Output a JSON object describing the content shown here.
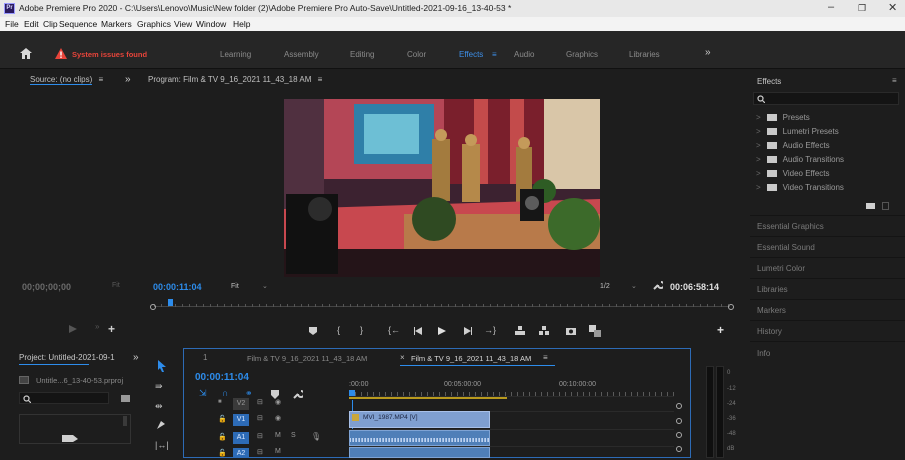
{
  "window": {
    "title": "Adobe Premiere Pro 2020 - C:\\Users\\Lenovo\\Music\\New folder (2)\\Adobe Premiere Pro Auto-Save\\Untitled-2021-09-16_13-40-53 *",
    "logo_text": "Pr",
    "controls": {
      "minimize": "–",
      "maximize": "❐",
      "close": "✕"
    }
  },
  "menu": [
    "File",
    "Edit",
    "Clip",
    "Sequence",
    "Markers",
    "Graphics",
    "View",
    "Window",
    "Help"
  ],
  "workspace": {
    "home_icon": "home-icon",
    "system_issues": "System issues found",
    "tabs": [
      "Learning",
      "Assembly",
      "Editing",
      "Color",
      "Effects",
      "Audio",
      "Graphics",
      "Libraries"
    ],
    "active_tab": "Effects",
    "overflow": "»",
    "tab_menu": "≡"
  },
  "source": {
    "header": "Source: (no clips)",
    "menu": "≡",
    "overflow": "»",
    "timecode": "00;00;00;00",
    "fit": "Fit"
  },
  "program": {
    "header": "Program: Film & TV 9_16_2021 11_43_18 AM",
    "menu": "≡",
    "timecode": "00:00:11:04",
    "fit": "Fit",
    "resolution": "1/2",
    "duration": "00:06:58:14",
    "playhead_fraction": 0.027
  },
  "effects_panel": {
    "title": "Effects",
    "menu": "≡",
    "items": [
      "Presets",
      "Lumetri Presets",
      "Audio Effects",
      "Audio Transitions",
      "Video Effects",
      "Video Transitions"
    ],
    "sections": [
      "Essential Graphics",
      "Essential Sound",
      "Lumetri Color",
      "Libraries",
      "Markers",
      "History",
      "Info"
    ]
  },
  "project": {
    "header": "Project: Untitled-2021-09-1",
    "overflow": "»",
    "file": "Untitle...6_13-40-53.prproj"
  },
  "timeline": {
    "tab1": "Film & TV 9_16_2021 11_43_18 AM",
    "tab2": "Film & TV 9_16_2021 11_43_18 AM",
    "tab2_close": "×",
    "tab_menu": "≡",
    "timecode": "00:00:11:04",
    "ruler": [
      ":00:00",
      "00:05:00:00",
      "00:10:00:00"
    ],
    "tracks": [
      "V2",
      "V1",
      "A1",
      "A2"
    ],
    "clip_video": "MVI_1987.MP4 [V]",
    "clip_fraction_start": 0.0,
    "clip_fraction_end": 0.435
  },
  "meter_scale": [
    "0",
    "-12",
    "-24",
    "-36",
    "-48",
    "dB"
  ],
  "colors": {
    "accent": "#2d8ceb",
    "warning": "#e8443a",
    "clip_video": "#7f9fd0",
    "clip_audio": "#4f7fb8",
    "panel": "#1d1d1d"
  }
}
